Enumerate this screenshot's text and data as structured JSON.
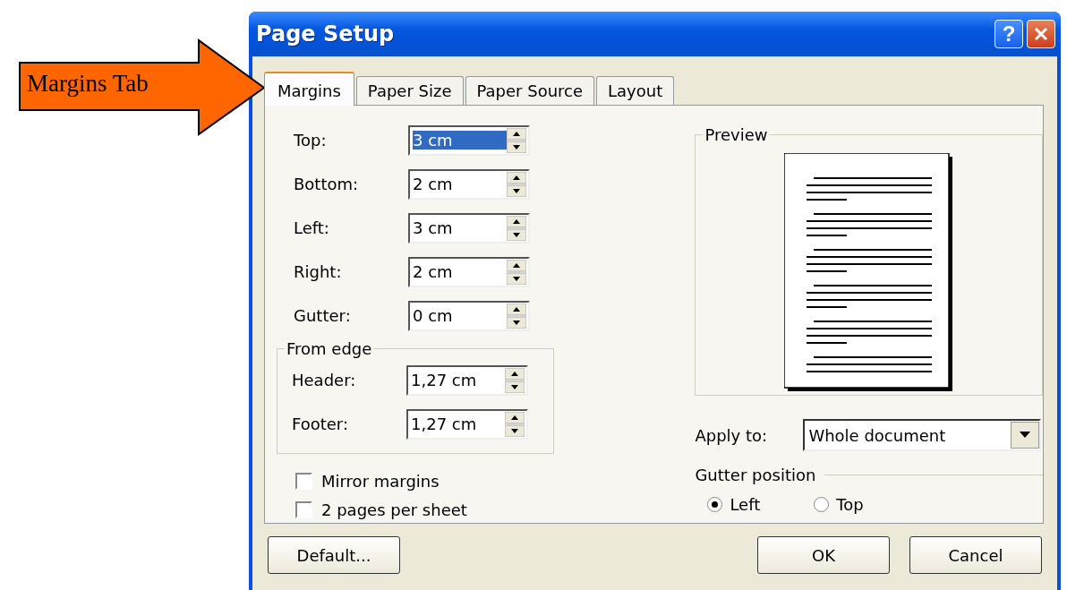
{
  "annotation": {
    "label": "Margins Tab"
  },
  "window": {
    "title": "Page Setup",
    "help": "?"
  },
  "tabs": [
    {
      "label": "Margins",
      "selected": true
    },
    {
      "label": "Paper Size",
      "selected": false
    },
    {
      "label": "Paper Source",
      "selected": false
    },
    {
      "label": "Layout",
      "selected": false
    }
  ],
  "margins": [
    {
      "label": "Top:",
      "value": "3 cm",
      "text_selected": true
    },
    {
      "label": "Bottom:",
      "value": "2 cm",
      "text_selected": false
    },
    {
      "label": "Left:",
      "value": "3 cm",
      "text_selected": false
    },
    {
      "label": "Right:",
      "value": "2 cm",
      "text_selected": false
    },
    {
      "label": "Gutter:",
      "value": "0 cm",
      "text_selected": false
    }
  ],
  "from_edge": {
    "title": "From edge",
    "fields": [
      {
        "label": "Header:",
        "value": "1,27 cm",
        "text_selected": false
      },
      {
        "label": "Footer:",
        "value": "1,27 cm",
        "text_selected": false
      }
    ]
  },
  "checkboxes": [
    {
      "label": "Mirror margins",
      "checked": false
    },
    {
      "label": "2 pages per sheet",
      "checked": false
    }
  ],
  "preview": {
    "title": "Preview"
  },
  "apply_to": {
    "label": "Apply to:",
    "value": "Whole document"
  },
  "gutter_position": {
    "title": "Gutter position",
    "options": [
      {
        "label": "Left",
        "selected": true
      },
      {
        "label": "Top",
        "selected": false
      }
    ]
  },
  "buttons": [
    {
      "label": "Default..."
    },
    {
      "label": "OK"
    },
    {
      "label": "Cancel"
    }
  ]
}
